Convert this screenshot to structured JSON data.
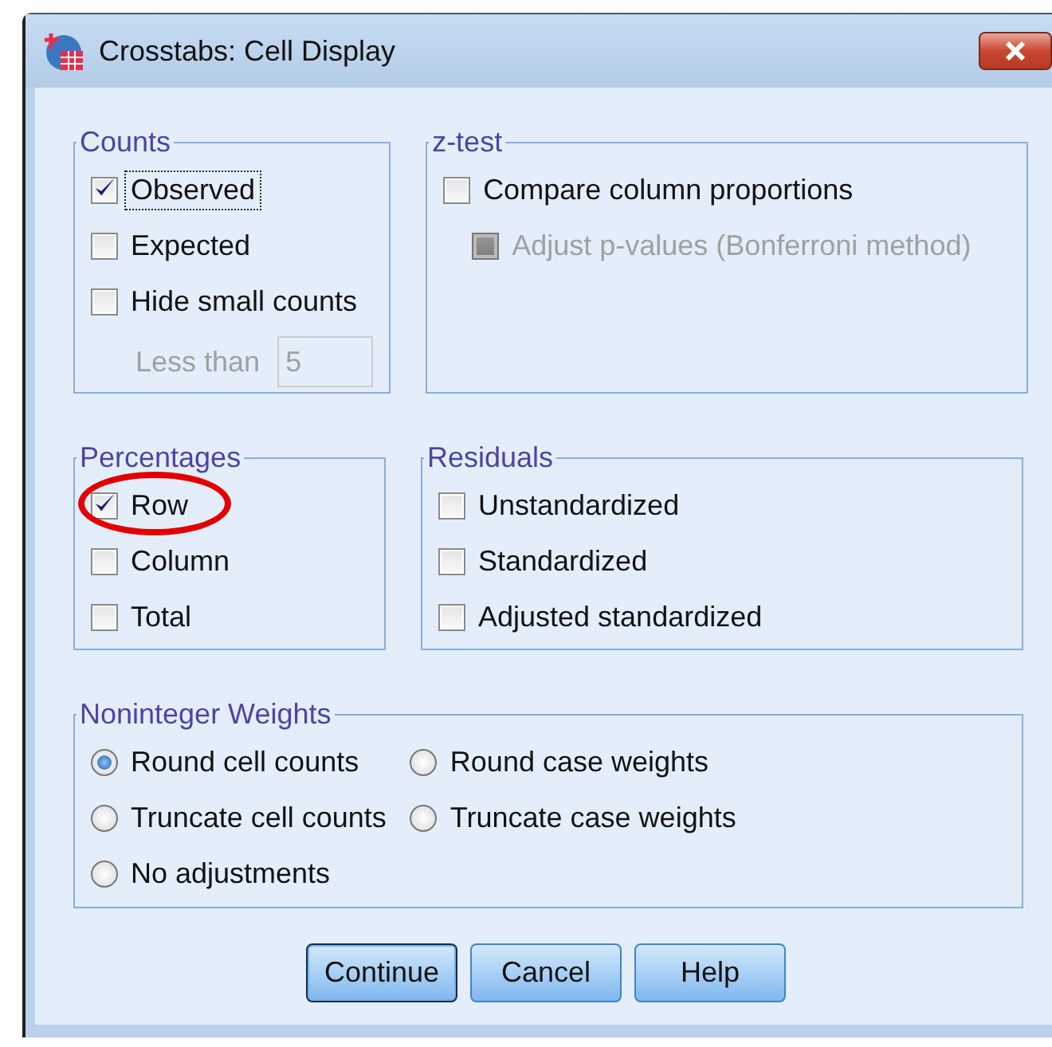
{
  "window": {
    "title": "Crosstabs: Cell Display"
  },
  "counts": {
    "title": "Counts",
    "items": [
      {
        "label": "Observed",
        "checked": true,
        "focused": true,
        "disabled": false
      },
      {
        "label": "Expected",
        "checked": false,
        "focused": false,
        "disabled": false
      },
      {
        "label": "Hide small counts",
        "checked": false,
        "focused": false,
        "disabled": false
      }
    ],
    "less_than": {
      "label": "Less than",
      "value": "5",
      "disabled": true
    }
  },
  "z_test": {
    "title": "z-test",
    "items": [
      {
        "label": "Compare column proportions",
        "checked": false,
        "disabled": false,
        "kind": "main"
      },
      {
        "label": "Adjust p-values (Bonferroni method)",
        "checked": false,
        "disabled": true,
        "kind": "sub"
      }
    ]
  },
  "percentages": {
    "title": "Percentages",
    "items": [
      {
        "label": "Row",
        "checked": true,
        "highlighted": true
      },
      {
        "label": "Column",
        "checked": false,
        "highlighted": false
      },
      {
        "label": "Total",
        "checked": false,
        "highlighted": false
      }
    ]
  },
  "residuals": {
    "title": "Residuals",
    "items": [
      {
        "label": "Unstandardized",
        "checked": false
      },
      {
        "label": "Standardized",
        "checked": false
      },
      {
        "label": "Adjusted standardized",
        "checked": false
      }
    ]
  },
  "weights": {
    "title": "Noninteger Weights",
    "options": [
      {
        "label": "Round cell counts",
        "selected": true
      },
      {
        "label": "Round case weights",
        "selected": false
      },
      {
        "label": "Truncate cell counts",
        "selected": false
      },
      {
        "label": "Truncate case weights",
        "selected": false
      },
      {
        "label": "No adjustments",
        "selected": false
      }
    ]
  },
  "buttons": [
    {
      "label": "Continue",
      "default": true
    },
    {
      "label": "Cancel",
      "default": false
    },
    {
      "label": "Help",
      "default": false
    }
  ]
}
